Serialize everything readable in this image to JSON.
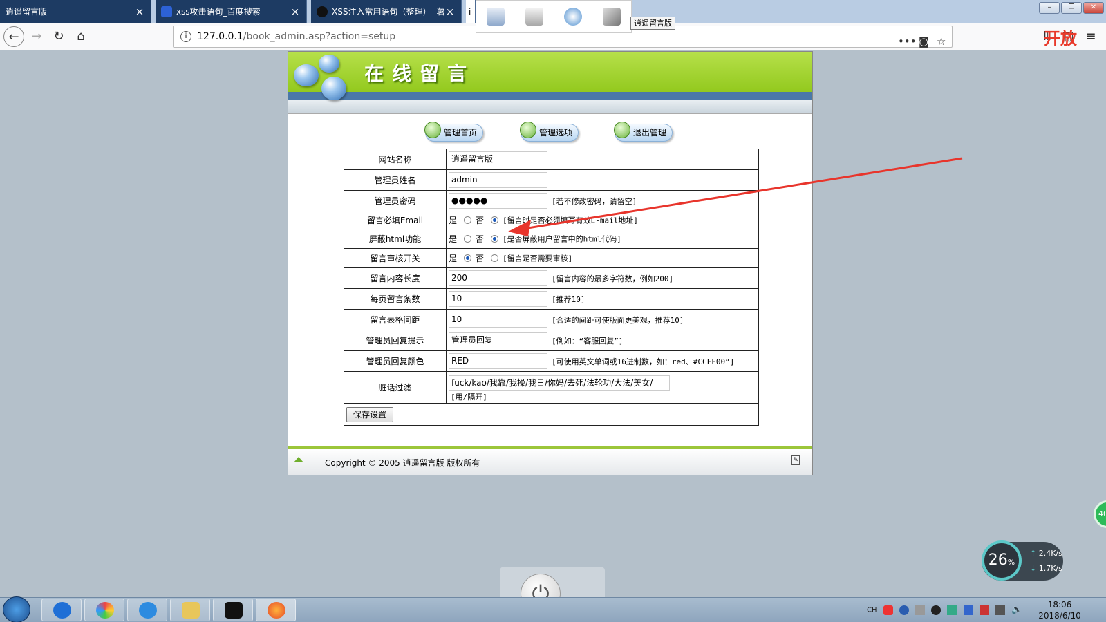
{
  "browser": {
    "tabs": [
      {
        "title": "逍遥留言版",
        "active": false
      },
      {
        "title": "xss攻击语句_百度搜索",
        "active": false
      },
      {
        "title": "XSS注入常用语句（整理）- 薯",
        "active": false
      },
      {
        "title": "i",
        "active": true
      }
    ],
    "tooltip": "逍遥留言版",
    "url_host": "127.0.0.1",
    "url_path": "/book_admin.asp?action=setup",
    "overlay_text": "开放"
  },
  "page": {
    "banner_title": "在线留言",
    "menu": [
      "管理首页",
      "管理选项",
      "退出管理"
    ],
    "settings": {
      "site_name": {
        "label": "网站名称",
        "value": "逍遥留言版"
      },
      "admin_name": {
        "label": "管理员姓名",
        "value": "admin"
      },
      "admin_password": {
        "label": "管理员密码",
        "value": "●●●●●",
        "note": "[若不修改密码，请留空]"
      },
      "require_email": {
        "label": "留言必填Email",
        "yes": "是",
        "no": "否",
        "selected": "no",
        "note": "[留言时是否必须填写有效E-mail地址]"
      },
      "block_html": {
        "label": "屏蔽html功能",
        "yes": "是",
        "no": "否",
        "selected": "no",
        "note": "[是否屏蔽用户留言中的html代码]"
      },
      "review_switch": {
        "label": "留言审核开关",
        "yes": "是",
        "no": "否",
        "selected": "yes",
        "note": "[留言是否需要审核]"
      },
      "content_length": {
        "label": "留言内容长度",
        "value": "200",
        "note": "[留言内容的最多字符数，例如200]"
      },
      "per_page": {
        "label": "每页留言条数",
        "value": "10",
        "note": "[推荐10]"
      },
      "table_spacing": {
        "label": "留言表格间距",
        "value": "10",
        "note": "[合适的间距可使版面更美观，推荐10]"
      },
      "reply_hint": {
        "label": "管理员回复提示",
        "value": "管理员回复",
        "note": "[例如：“客服回复”]"
      },
      "reply_color": {
        "label": "管理员回复颜色",
        "value": "RED",
        "note": "[可使用英文单词或16进制数，如：red、#CCFF00”]"
      },
      "dirty_filter": {
        "label": "脏话过滤",
        "value": "fuck/kao/我靠/我操/我日/你妈/去死/法轮功/大法/美女/",
        "note": "[用/隔开]"
      }
    },
    "save_label": "保存设置",
    "footer": "Copyright © 2005 逍遥留言版 版权所有"
  },
  "desktop": {
    "cpu_percent": "26",
    "cpu_unit": "%",
    "upload": "2.4K/s",
    "download": "1.7K/s",
    "float_ball": "40",
    "tray_lang": "CH",
    "clock_time": "18:06",
    "clock_date": "2018/6/10"
  },
  "colors": {
    "banner": "#9ccb2a",
    "tab_bg": "#1d3b63",
    "arrow": "#e8352c"
  }
}
